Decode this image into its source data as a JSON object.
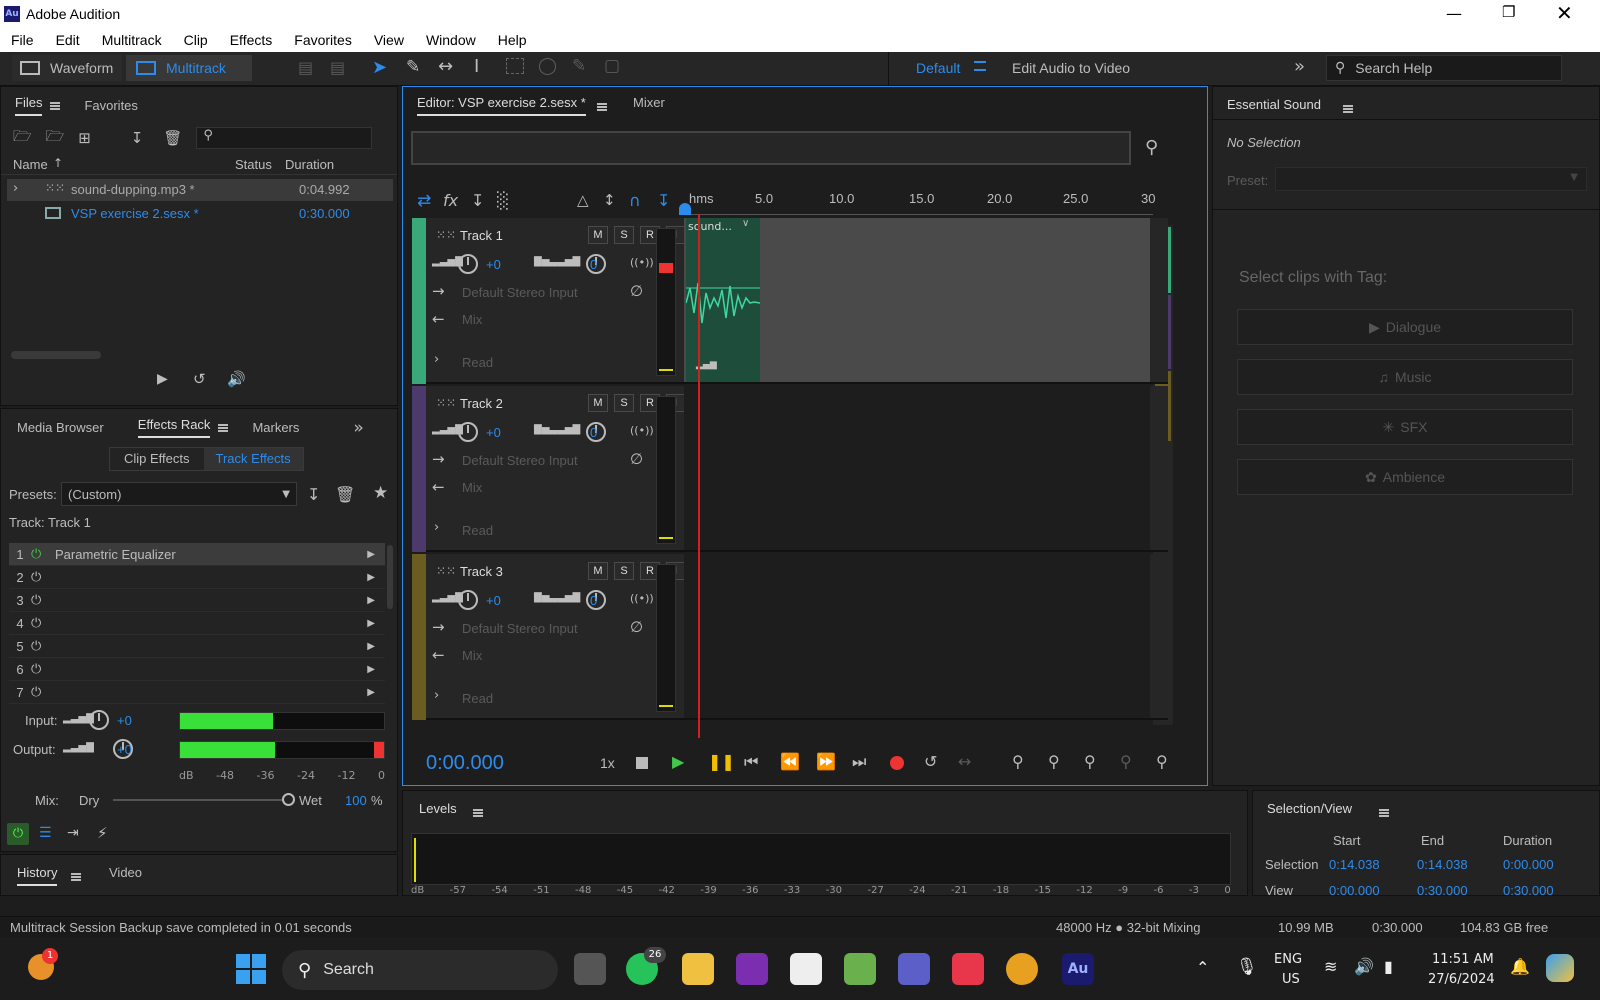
{
  "app": {
    "title": "Adobe Audition",
    "logo": "Au"
  },
  "menu": [
    "File",
    "Edit",
    "Multitrack",
    "Clip",
    "Effects",
    "Favorites",
    "View",
    "Window",
    "Help"
  ],
  "toolbar": {
    "waveform": "Waveform",
    "multitrack": "Multitrack",
    "workspace": "Default",
    "edit_audio_to_video": "Edit Audio to Video",
    "search_help": "Search Help"
  },
  "files_panel": {
    "tab_files": "Files",
    "tab_favorites": "Favorites",
    "col_name": "Name",
    "col_status": "Status",
    "col_duration": "Duration",
    "files": [
      {
        "name": "sound-dupping.mp3 *",
        "duration": "0:04.992"
      },
      {
        "name": "VSP exercise 2.sesx *",
        "duration": "0:30.000"
      }
    ]
  },
  "effects_panel": {
    "tab_media": "Media Browser",
    "tab_effects": "Effects Rack",
    "tab_markers": "Markers",
    "clip_effects": "Clip Effects",
    "track_effects": "Track Effects",
    "presets_label": "Presets:",
    "preset_value": "(Custom)",
    "track_label": "Track: Track 1",
    "slots": [
      {
        "n": "1",
        "name": "Parametric Equalizer"
      },
      {
        "n": "2",
        "name": ""
      },
      {
        "n": "3",
        "name": ""
      },
      {
        "n": "4",
        "name": ""
      },
      {
        "n": "5",
        "name": ""
      },
      {
        "n": "6",
        "name": ""
      },
      {
        "n": "7",
        "name": ""
      }
    ],
    "input_label": "Input:",
    "input_val": "+0",
    "output_label": "Output:",
    "output_val": "+0",
    "input_level": 0.76,
    "output_level": 0.78,
    "scale": [
      "dB",
      "-48",
      "-36",
      "-24",
      "-12",
      "0"
    ],
    "mix_label": "Mix:",
    "dry": "Dry",
    "wet": "Wet",
    "mix_val": "100",
    "mix_unit": "%",
    "mix_level": 1.0
  },
  "history": {
    "tab_history": "History",
    "tab_video": "Video"
  },
  "editor": {
    "tab": "Editor: VSP exercise 2.sesx *",
    "mixer": "Mixer",
    "ruler": [
      "hms",
      "5.0",
      "10.0",
      "15.0",
      "20.0",
      "25.0",
      "30"
    ],
    "tracks": [
      {
        "name": "Track 1",
        "vol": "+0",
        "pan": "0",
        "input": "Default Stereo Input",
        "output": "Mix",
        "mode": "Read",
        "color": "#3aa97a"
      },
      {
        "name": "Track 2",
        "vol": "+0",
        "pan": "0",
        "input": "Default Stereo Input",
        "output": "Mix",
        "mode": "Read",
        "color": "#4b3a6b"
      },
      {
        "name": "Track 3",
        "vol": "+0",
        "pan": "0",
        "input": "Default Stereo Input",
        "output": "Mix",
        "mode": "Read",
        "color": "#6b5d22"
      }
    ],
    "clip_name": "sound...",
    "time": "0:00.000",
    "speed": "1x"
  },
  "essential": {
    "title": "Essential Sound",
    "no_selection": "No Selection",
    "preset": "Preset:",
    "select_tag": "Select clips with Tag:",
    "tags": [
      "Dialogue",
      "Music",
      "SFX",
      "Ambience"
    ]
  },
  "levels": {
    "title": "Levels",
    "scale": [
      "dB",
      "-57",
      "-54",
      "-51",
      "-48",
      "-45",
      "-42",
      "-39",
      "-36",
      "-33",
      "-30",
      "-27",
      "-24",
      "-21",
      "-18",
      "-15",
      "-12",
      "-9",
      "-6",
      "-3",
      "0"
    ]
  },
  "selection_view": {
    "title": "Selection/View",
    "start": "Start",
    "end": "End",
    "duration": "Duration",
    "rows": [
      {
        "label": "Selection",
        "start": "0:14.038",
        "end": "0:14.038",
        "duration": "0:00.000"
      },
      {
        "label": "View",
        "start": "0:00.000",
        "end": "0:30.000",
        "duration": "0:30.000"
      }
    ]
  },
  "status": {
    "message": "Multitrack Session Backup save completed in 0.01 seconds",
    "format": "48000 Hz ● 32-bit Mixing",
    "size": "10.99 MB",
    "duration": "0:30.000",
    "free": "104.83 GB free"
  },
  "taskbar": {
    "search": "Search",
    "lang1": "ENG",
    "lang2": "US",
    "time": "11:51 AM",
    "date": "27/6/2024",
    "whatsapp_badge": "26",
    "widget_badge": "1"
  },
  "colors": {
    "accent": "#2d8ceb",
    "track1": "#3aa97a",
    "play": "#3fc84a",
    "pause": "#f0c000",
    "record": "#e33"
  }
}
